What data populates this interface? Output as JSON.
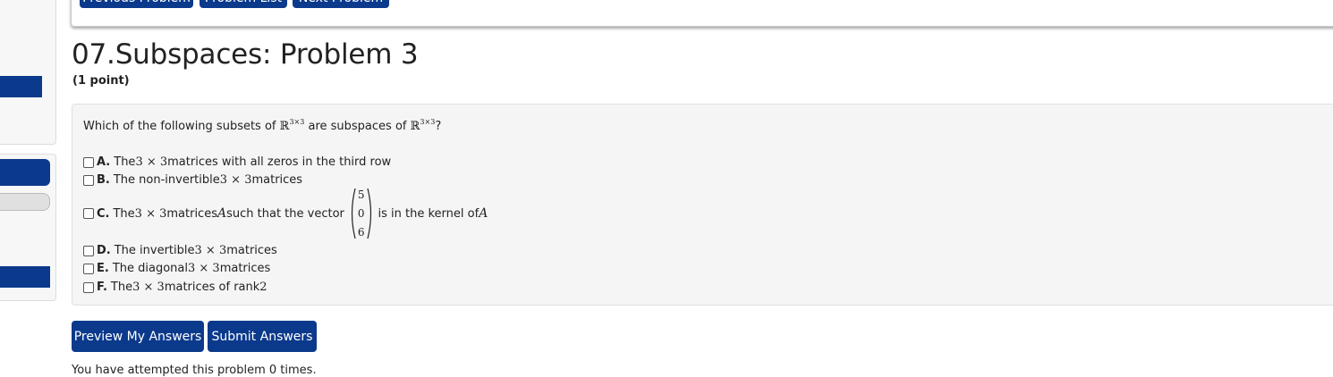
{
  "nav": {
    "previous": "Previous Problem",
    "list": "Problem List",
    "next": "Next Problem"
  },
  "problem": {
    "title": "07.Subspaces: Problem 3",
    "points": "(1 point)",
    "question_pre": "Which of the following subsets of ",
    "question_mid": " are subspaces of ",
    "question_post": "?",
    "space": "ℝ",
    "space_exp": "3×3",
    "options": [
      {
        "letter": "A.",
        "pre": "The ",
        "math": "3 × 3",
        "post": " matrices with all zeros in the third row"
      },
      {
        "letter": "B.",
        "pre": "The non-invertible ",
        "math": "3 × 3",
        "post": " matrices"
      },
      {
        "letter": "C.",
        "pre": "The ",
        "math": "3 × 3",
        "mid": " matrices ",
        "var": "A",
        "mid2": " such that the vector",
        "vector": [
          "5",
          "0",
          "6"
        ],
        "post": "is in the kernel of ",
        "var2": "A"
      },
      {
        "letter": "D.",
        "pre": "The invertible ",
        "math": "3 × 3",
        "post": " matrices"
      },
      {
        "letter": "E.",
        "pre": "The diagonal ",
        "math": "3 × 3",
        "post": " matrices"
      },
      {
        "letter": "F.",
        "pre": "The ",
        "math": "3 × 3",
        "post": " matrices of rank ",
        "math2": "2"
      }
    ]
  },
  "actions": {
    "preview": "Preview My Answers",
    "submit": "Submit Answers"
  },
  "status": {
    "attempts": "You have attempted this problem 0 times."
  },
  "colors": {
    "primary": "#0b3a8c",
    "panel": "#f5f5f5"
  }
}
